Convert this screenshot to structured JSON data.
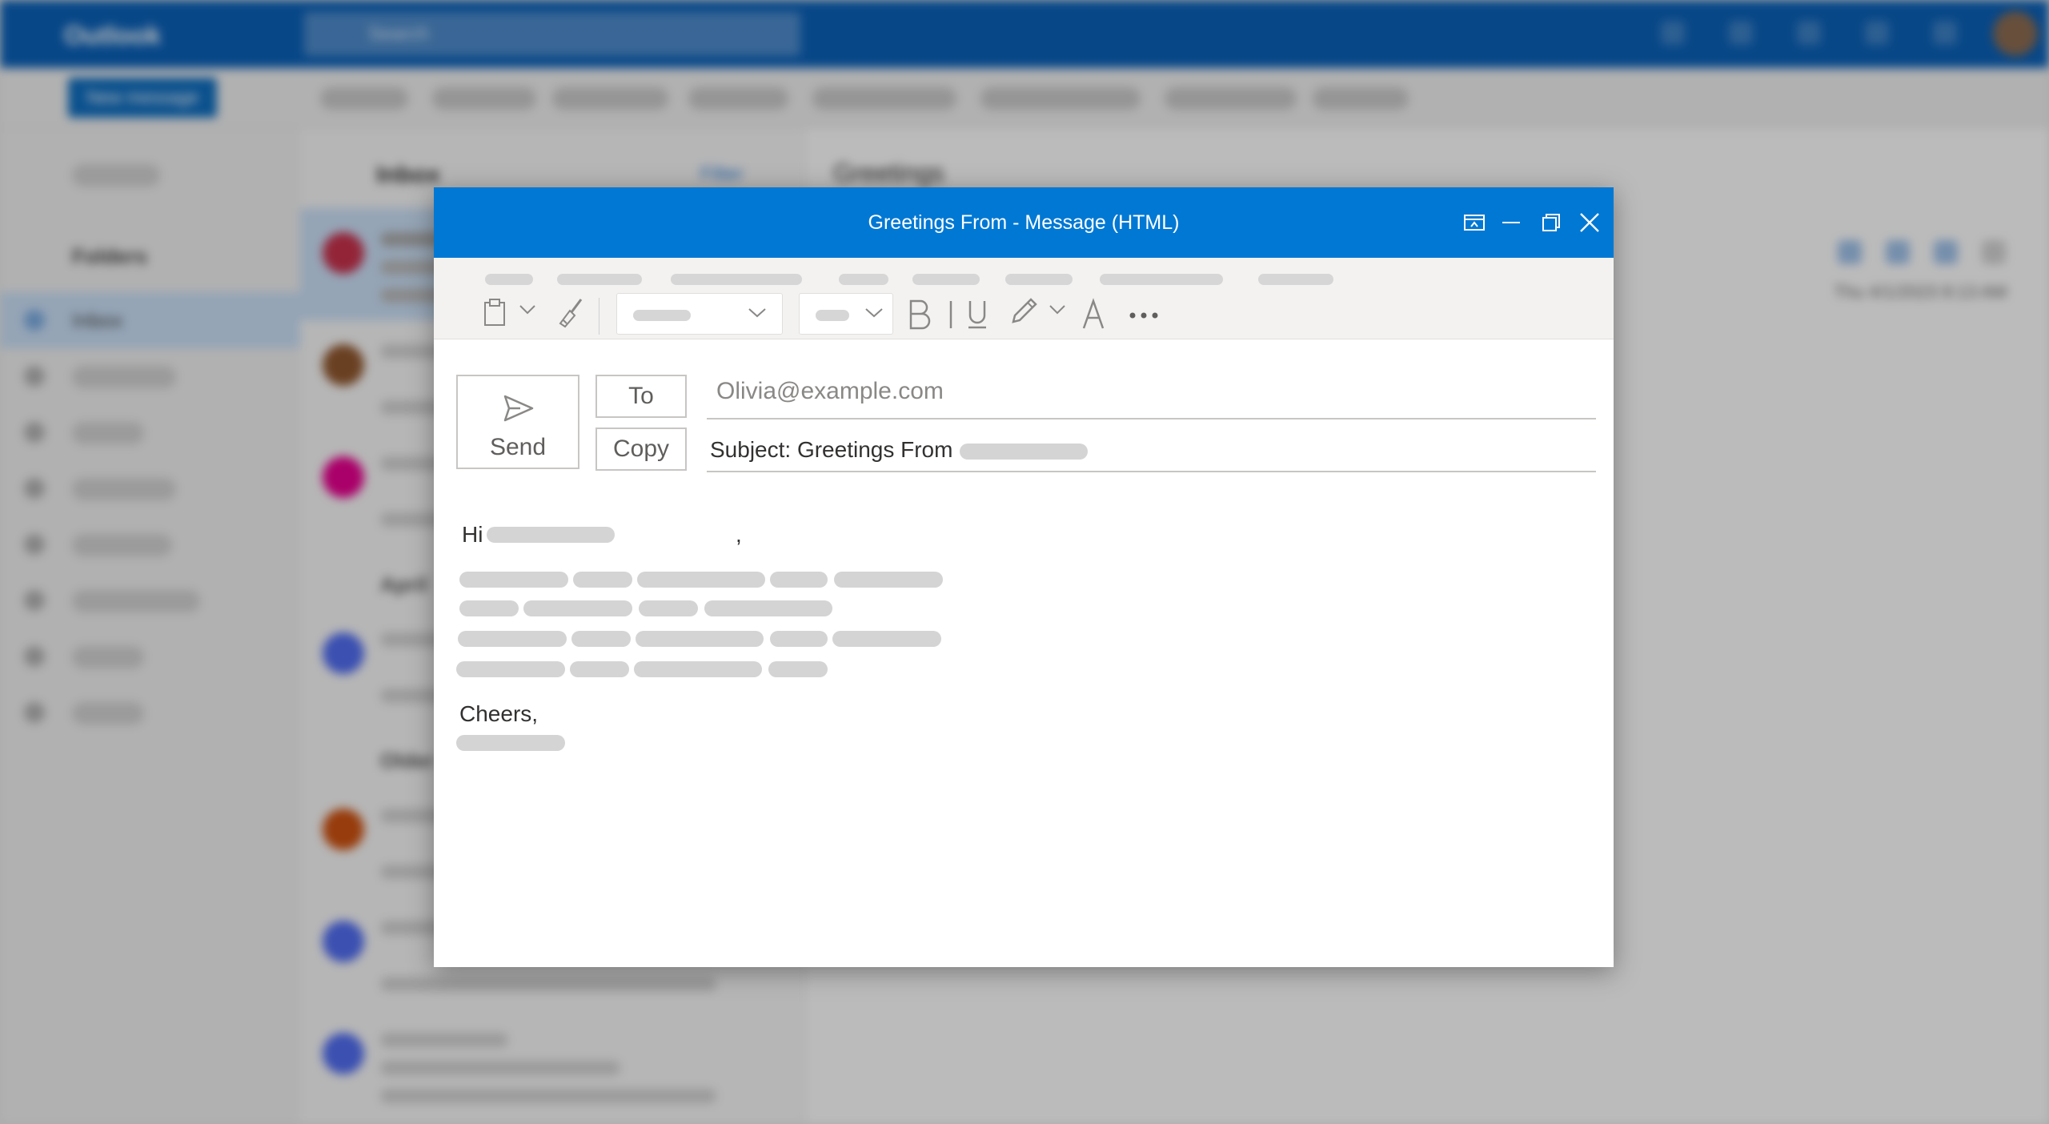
{
  "background_app": {
    "app_name": "Outlook",
    "search_placeholder": "Search",
    "new_message_label": "New message",
    "nav": {
      "folders_label": "Folders",
      "inbox_label": "Inbox"
    },
    "mail_list": {
      "header": "Inbox",
      "filter_label": "Filter",
      "groups": [
        "April",
        "Older"
      ]
    },
    "reading_pane": {
      "subject": "Greetings",
      "date": "Thu 4/1/2023 8:13 AM"
    }
  },
  "compose": {
    "window_title": "Greetings From - Message (HTML)",
    "send_label": "Send",
    "to_button_label": "To",
    "copy_button_label": "Copy",
    "to_value": "Olivia@example.com",
    "subject_label": "Subject: Greetings From",
    "greeting_hi": "Hi",
    "greeting_comma": ",",
    "closing": "Cheers,"
  },
  "colors": {
    "titlebar": "#0078d4",
    "outlook_header": "#0a5fb5",
    "ribbon": "#f3f2f1",
    "redaction": "#d4d4d4"
  },
  "icons": [
    "paste-icon",
    "format-painter-icon",
    "bold-icon",
    "italic-icon",
    "underline-icon",
    "highlight-icon",
    "font-color-icon",
    "more-icon",
    "send-icon",
    "popout-icon",
    "minimize-icon",
    "restore-icon",
    "close-icon"
  ]
}
